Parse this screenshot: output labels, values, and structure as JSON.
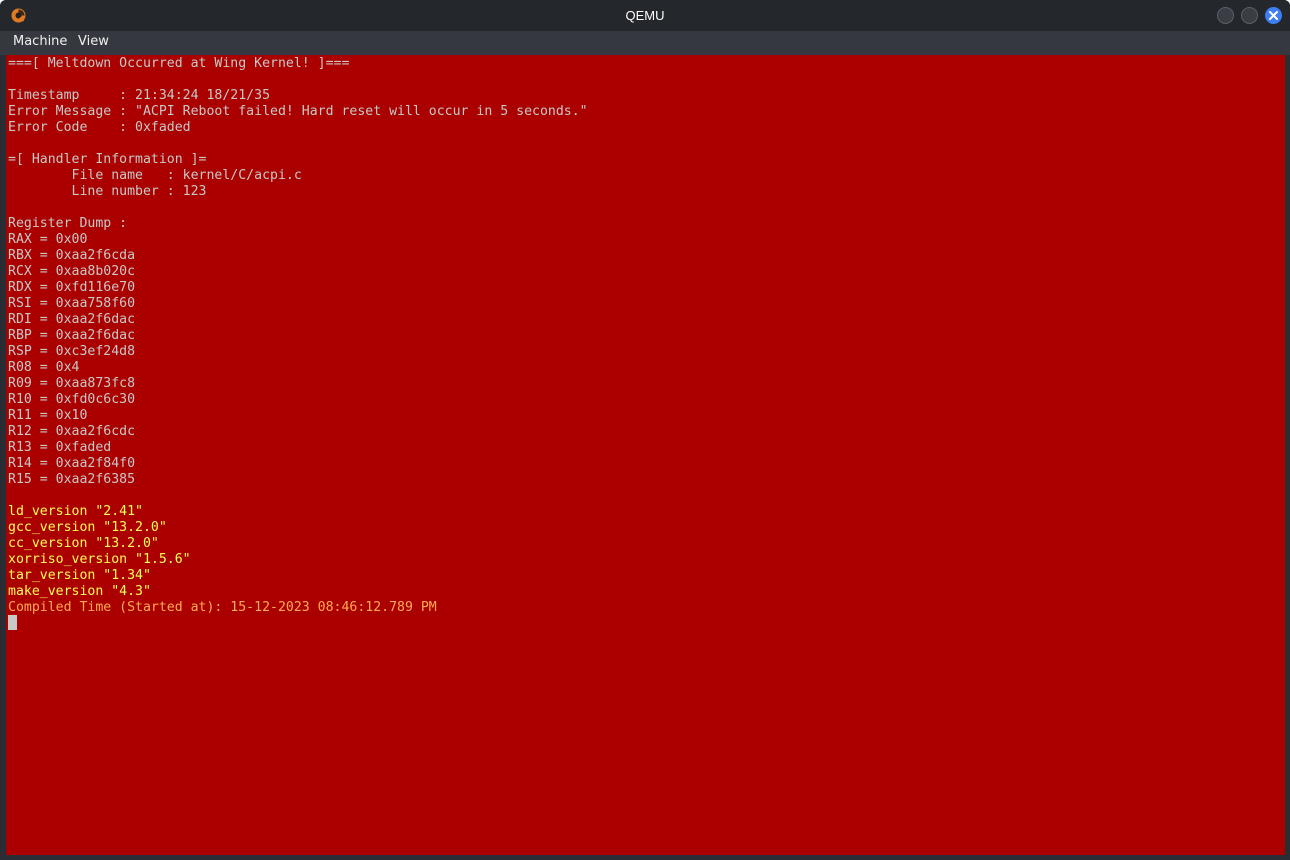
{
  "window": {
    "title": "QEMU",
    "app_icon": "qemu-logo-icon",
    "controls": [
      "minimize-icon",
      "maximize-icon",
      "close-icon"
    ]
  },
  "menu": {
    "machine": "Machine",
    "view": "View"
  },
  "console": {
    "background": "#aa0000",
    "lines": [
      {
        "text": "===[ Meltdown Occurred at Wing Kernel! ]===",
        "color": "#c8c8c8"
      },
      {
        "text": "",
        "color": "#c8c8c8"
      },
      {
        "text": "Timestamp     : 21:34:24 18/21/35",
        "color": "#c8c8c8"
      },
      {
        "text": "Error Message : \"ACPI Reboot failed! Hard reset will occur in 5 seconds.\"",
        "color": "#c8c8c8"
      },
      {
        "text": "Error Code    : 0xfaded",
        "color": "#c8c8c8"
      },
      {
        "text": "",
        "color": "#c8c8c8"
      },
      {
        "text": "=[ Handler Information ]=",
        "color": "#c8c8c8"
      },
      {
        "text": "        File name   : kernel/C/acpi.c",
        "color": "#c8c8c8"
      },
      {
        "text": "        Line number : 123",
        "color": "#c8c8c8"
      },
      {
        "text": "",
        "color": "#c8c8c8"
      },
      {
        "text": "Register Dump :",
        "color": "#c8c8c8"
      },
      {
        "text": "RAX = 0x00",
        "color": "#c8c8c8"
      },
      {
        "text": "RBX = 0xaa2f6cda",
        "color": "#c8c8c8"
      },
      {
        "text": "RCX = 0xaa8b020c",
        "color": "#c8c8c8"
      },
      {
        "text": "RDX = 0xfd116e70",
        "color": "#c8c8c8"
      },
      {
        "text": "RSI = 0xaa758f60",
        "color": "#c8c8c8"
      },
      {
        "text": "RDI = 0xaa2f6dac",
        "color": "#c8c8c8"
      },
      {
        "text": "RBP = 0xaa2f6dac",
        "color": "#c8c8c8"
      },
      {
        "text": "RSP = 0xc3ef24d8",
        "color": "#c8c8c8"
      },
      {
        "text": "R08 = 0x4",
        "color": "#c8c8c8"
      },
      {
        "text": "R09 = 0xaa873fc8",
        "color": "#c8c8c8"
      },
      {
        "text": "R10 = 0xfd0c6c30",
        "color": "#c8c8c8"
      },
      {
        "text": "R11 = 0x10",
        "color": "#c8c8c8"
      },
      {
        "text": "R12 = 0xaa2f6cdc",
        "color": "#c8c8c8"
      },
      {
        "text": "R13 = 0xfaded",
        "color": "#c8c8c8"
      },
      {
        "text": "R14 = 0xaa2f84f0",
        "color": "#c8c8c8"
      },
      {
        "text": "R15 = 0xaa2f6385",
        "color": "#c8c8c8"
      },
      {
        "text": "",
        "color": "#c8c8c8"
      },
      {
        "text": "ld_version \"2.41\"",
        "color": "#ffff55"
      },
      {
        "text": "gcc_version \"13.2.0\"",
        "color": "#ffff55"
      },
      {
        "text": "cc_version \"13.2.0\"",
        "color": "#ffff55"
      },
      {
        "text": "xorriso_version \"1.5.6\"",
        "color": "#ffff55"
      },
      {
        "text": "tar_version \"1.34\"",
        "color": "#ffff55"
      },
      {
        "text": "make_version \"4.3\"",
        "color": "#ffff55"
      },
      {
        "text": "Compiled Time (Started at): 15-12-2023 08:46:12.789 PM",
        "color": "#ffaa55"
      }
    ]
  }
}
